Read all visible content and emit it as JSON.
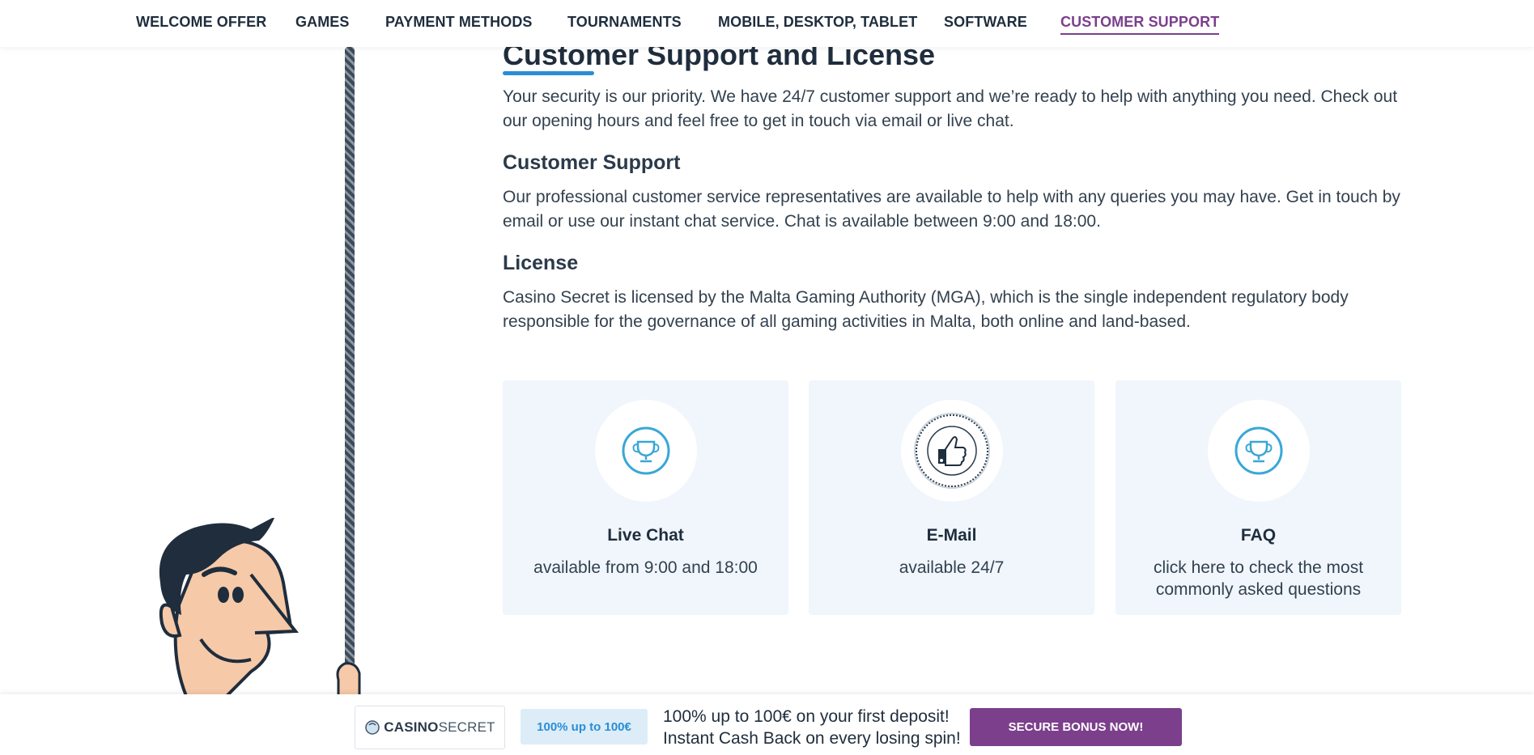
{
  "nav": {
    "items": [
      {
        "label": "WELCOME OFFER"
      },
      {
        "label": "GAMES"
      },
      {
        "label": "PAYMENT METHODS"
      },
      {
        "label": "TOURNAMENTS"
      },
      {
        "label": "MOBILE, DESKTOP, TABLET"
      },
      {
        "label": "SOFTWARE"
      },
      {
        "label": "CUSTOMER SUPPORT"
      }
    ],
    "active": "CUSTOMER SUPPORT"
  },
  "main": {
    "title": "Customer Support and License",
    "intro": "Your security is our priority. We have 24/7 customer support and we’re ready to help with anything you need. Check out our opening hours and feel free to get in touch via email or live chat.",
    "support_heading": "Customer Support",
    "support_text": "Our professional customer service representatives are available to help with any queries you may have. Get in touch by email or use our instant chat service. Chat is available between 9:00 and 18:00.",
    "license_heading": "License",
    "license_text": "Casino Secret is licensed by the Malta Gaming Authority (MGA), which is the single independent regulatory body responsible for the governance of all gaming activities in Malta, both online and land-based."
  },
  "cards": [
    {
      "title": "Live Chat",
      "sub": "available from 9:00 and 18:00",
      "icon": "trophy-icon"
    },
    {
      "title": "E-Mail",
      "sub": "available 24/7",
      "icon": "cashback-certified-badge",
      "badge_text": "CASHBACK CERTIFIED"
    },
    {
      "title": "FAQ",
      "sub": "click here to check the most commonly asked questions",
      "icon": "trophy-icon"
    }
  ],
  "bottom_bar": {
    "logo_bold": "CASINO",
    "logo_light": "SECRET",
    "badge": "100% up to 100€",
    "promo_line1": "100% up to 100€ on your first deposit!",
    "promo_line2": "Instant Cash Back on every losing spin!",
    "cta": "SECURE BONUS NOW!"
  },
  "colors": {
    "accent_purple": "#7b3f8c",
    "accent_blue": "#2b8dd6",
    "card_bg": "#f0f6fb",
    "text_dark": "#1f2d3d"
  }
}
